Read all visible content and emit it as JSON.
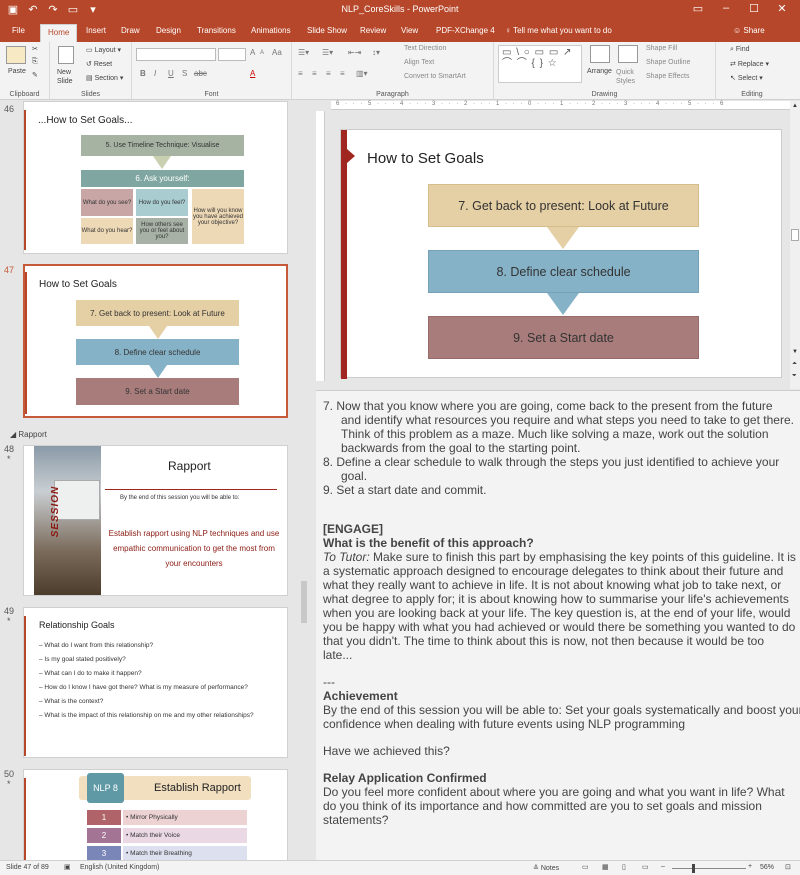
{
  "titlebar": {
    "title": "NLP_CoreSkills - PowerPoint"
  },
  "ribbon_tabs": [
    "File",
    "Home",
    "Insert",
    "Draw",
    "Design",
    "Transitions",
    "Animations",
    "Slide Show",
    "Review",
    "View",
    "PDF-XChange 4"
  ],
  "tell_me": "Tell me what you want to do",
  "share": "Share",
  "ribbon": {
    "clipboard": {
      "paste": "Paste",
      "label": "Clipboard"
    },
    "slides": {
      "new_slide": "New Slide",
      "layout": "Layout",
      "reset": "Reset",
      "section": "Section",
      "label": "Slides"
    },
    "font": {
      "label": "Font",
      "bold": "B",
      "italic": "I",
      "underline": "U",
      "strike": "S",
      "shadow": "abc",
      "size_up": "A",
      "size_down": "A",
      "clear": "Aa",
      "color": "A"
    },
    "paragraph": {
      "label": "Paragraph",
      "text_direction": "Text Direction",
      "align_text": "Align Text",
      "convert_smartart": "Convert to SmartArt"
    },
    "drawing": {
      "label": "Drawing",
      "arrange": "Arrange",
      "quick_styles": "Quick Styles",
      "shape_fill": "Shape Fill",
      "shape_outline": "Shape Outline",
      "shape_effects": "Shape Effects",
      "shapes": "▭ \\ ○ ▭ ▭ ↗ ⌒ ⌒ { } ☆"
    },
    "editing": {
      "label": "Editing",
      "find": "Find",
      "replace": "Replace",
      "select": "Select"
    }
  },
  "thumbnails": {
    "s46": {
      "num": "46",
      "title": "...How to Set Goals...",
      "box1": "5. Use Timeline Technique:  Visualise",
      "box2": "6. Ask yourself:",
      "q1": "What do you see?",
      "q2": "How do you feel?",
      "q3": "How will you know you have achieved your objective?",
      "q4": "What do you hear?",
      "q5": "How others see you or feel about you?"
    },
    "s47": {
      "num": "47",
      "title": "How to Set Goals",
      "box1": "7. Get back to present: Look at Future",
      "box2": "8. Define clear schedule",
      "box3": "9. Set a Start date"
    },
    "section": "Rapport",
    "s48": {
      "num": "48",
      "star": "*",
      "title": "Rapport",
      "session": "SESSION",
      "sub": "By the end of this session you will be able to:",
      "body": "Establish rapport using NLP techniques and use empathic communication to get the most from your encounters"
    },
    "s49": {
      "num": "49",
      "star": "*",
      "title": "Relationship Goals",
      "items": [
        "What do I want from this relationship?",
        "Is my goal stated positively?",
        "What can I do to make it happen?",
        "How do I know I have got there? What is my measure of performance?",
        "What is the context?",
        "What is the impact of this relationship on me and my other relationships?"
      ]
    },
    "s50": {
      "num": "50",
      "star": "*",
      "badge": "NLP 8",
      "title": "Establish Rapport",
      "rows": [
        {
          "n": "1",
          "t": "Mirror Physically"
        },
        {
          "n": "2",
          "t": "Match their Voice"
        },
        {
          "n": "3",
          "t": "Match their Breathing"
        }
      ]
    }
  },
  "main_slide": {
    "title": "How to Set Goals",
    "box1": "7. Get back to present: Look at Future",
    "box2": "8. Define clear schedule",
    "box3": "9. Set a Start date",
    "colors": {
      "box1": "#e5cfa4",
      "box2": "#86b2c7",
      "box3": "#a97c7c",
      "accent": "#a0271f"
    }
  },
  "notes": {
    "p7a": "7.   Now that you know where you are going, come back to the present from the future",
    "p7b": "and identify what resources you require and what steps you need to take to get there.",
    "p7c": "Think of this problem as a maze. Much like solving a maze, work out the solution",
    "p7d": "backwards from the goal to the starting point.",
    "p8a": "8.   Define a clear schedule to walk through the steps you just identified to achieve your",
    "p8b": "goal.",
    "p9": "9.   Set a start date and commit.",
    "engage": "[ENGAGE]",
    "q": "What is the benefit of this approach?",
    "tutor_label": "To Tutor:",
    "t1": " Make sure to finish this part by emphasising the key points of this guideline. It is",
    "t2": "a systematic approach designed to encourage delegates to think about their future and",
    "t3": "what they really want to achieve in life. It is not about knowing what job to take next, or",
    "t4": "what degree to apply for; it is about knowing how to summarise your life's achievements",
    "t5": "when you are looking back at your life. The key question is, at the end of your life, would",
    "t6": "you be happy with what you had achieved or would there be something you wanted to do",
    "t7": "that you didn't. The time to think about this is now, not then because it would be too",
    "t8": "late...",
    "sep": "---",
    "ach": "Achievement",
    "a1": "By the end of this session you will be able to: Set your goals systematically and boost your",
    "a2": "confidence when dealing with future events using NLP programming",
    "have": "Have we achieved this?",
    "relay": "Relay Application Confirmed",
    "r1": "Do you feel more confident about where you are going and what you want in life? What",
    "r2": "do you think of its importance and how committed are you to set goals and mission",
    "r3": "statements?"
  },
  "status": {
    "slide": "Slide 47 of 89",
    "lang": "English (United Kingdom)",
    "notes": "Notes",
    "zoom": "56%"
  }
}
